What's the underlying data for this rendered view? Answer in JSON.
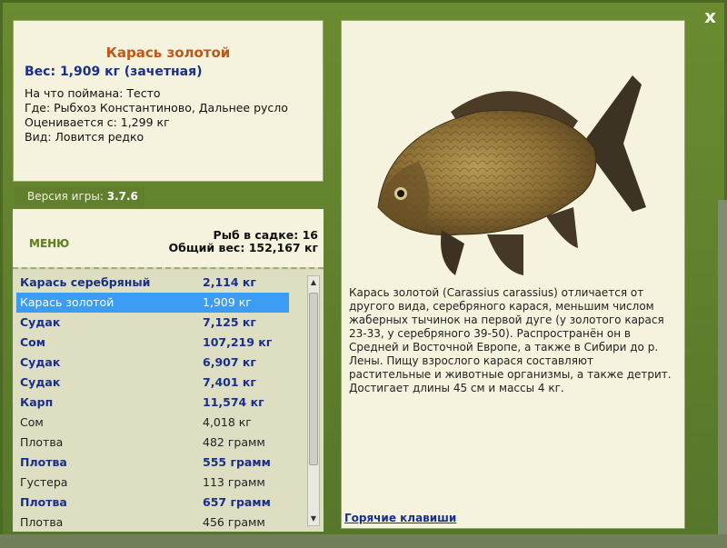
{
  "window": {
    "close_label": "x"
  },
  "fish": {
    "title": "Карась золотой",
    "weight_line": "Вес: 1,909 кг (зачетная)",
    "info": [
      "На что поймана: Тесто",
      "Где: Рыбхоз Константиново, Дальнее русло",
      "Оценивается с: 1,299 кг",
      "Вид: Ловится редко"
    ]
  },
  "version": {
    "label": "Версия игры:",
    "value": "3.7.6"
  },
  "menu": {
    "label": "МЕНЮ"
  },
  "stats": {
    "count_line": "Рыб в садке: 16",
    "total_line": "Общий вес: 152,167 кг"
  },
  "catch_list": [
    {
      "name": "Карась серебряный",
      "weight": "2,114 кг",
      "style": "bold"
    },
    {
      "name": "Карась золотой",
      "weight": "1,909 кг",
      "style": "selected"
    },
    {
      "name": "Судак",
      "weight": "7,125 кг",
      "style": "bold"
    },
    {
      "name": "Сом",
      "weight": "107,219 кг",
      "style": "bold"
    },
    {
      "name": "Судак",
      "weight": "6,907 кг",
      "style": "bold"
    },
    {
      "name": "Судак",
      "weight": "7,401 кг",
      "style": "bold"
    },
    {
      "name": "Карп",
      "weight": "11,574 кг",
      "style": "bold"
    },
    {
      "name": "Сом",
      "weight": "4,018 кг",
      "style": "plain"
    },
    {
      "name": "Плотва",
      "weight": "482 грамм",
      "style": "plain"
    },
    {
      "name": "Плотва",
      "weight": "555 грамм",
      "style": "bold"
    },
    {
      "name": "Густера",
      "weight": "113 грамм",
      "style": "plain"
    },
    {
      "name": "Плотва",
      "weight": "657 грамм",
      "style": "bold"
    },
    {
      "name": "Плотва",
      "weight": "456 грамм",
      "style": "plain"
    }
  ],
  "description": "Карась золотой (Carassius carassius) отличается от другого вида, серебряного карася, меньшим числом жаберных тычинок на первой дуге (у золотого карася 23-33, у серебряного 39-50). Распространён он в Средней и Восточной Европе, а также в Сибири до р. Лены. Пищу взрослого карася составляют растительные и животные организмы, а также детрит. Достигает длины 45 см и массы 4 кг.",
  "hotkeys": {
    "label": "Горячие клавиши"
  },
  "icons": {
    "close": "close-icon",
    "scroll_up": "arrow-up-icon",
    "scroll_down": "arrow-down-icon",
    "fish": "fish-illustration"
  },
  "colors": {
    "frame": "#5f7f2c",
    "panel": "#f5f3dd",
    "selected": "#3b9cf2",
    "title": "#c0561a",
    "bold_text": "#1a2f8a"
  }
}
